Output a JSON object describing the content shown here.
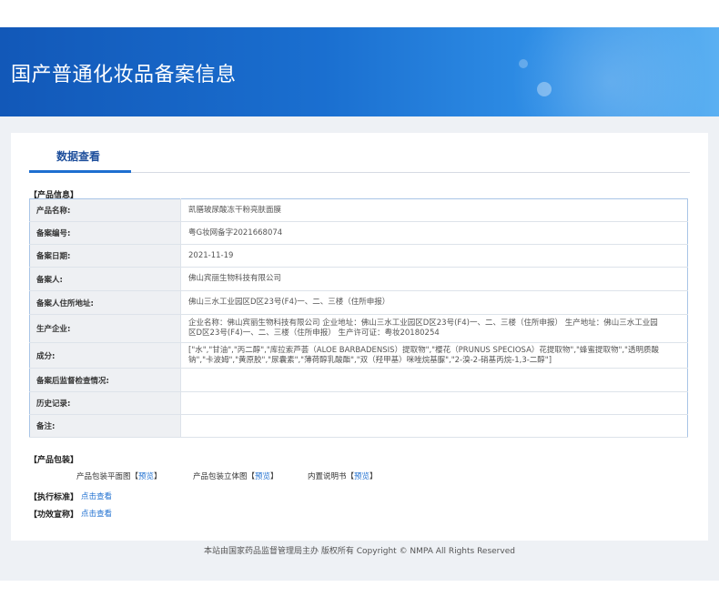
{
  "header": {
    "title": "国产普通化妆品备案信息"
  },
  "tab": {
    "label": "数据查看"
  },
  "product_info": {
    "section_label": "【产品信息】",
    "rows": [
      {
        "label": "产品名称:",
        "value": "凯膳玻尿酸冻干粉亮肤面膜"
      },
      {
        "label": "备案编号:",
        "value": "粤G妆网备字2021668074"
      },
      {
        "label": "备案日期:",
        "value": "2021-11-19"
      },
      {
        "label": "备案人:",
        "value": "佛山宾丽生物科技有限公司"
      },
      {
        "label": "备案人住所地址:",
        "value": "佛山三水工业园区D区23号(F4)一、二、三楼（住所申报）"
      },
      {
        "label": "生产企业:",
        "value": "企业名称：佛山宾丽生物科技有限公司 企业地址：佛山三水工业园区D区23号(F4)一、二、三楼（住所申报） 生产地址：佛山三水工业园区D区23号(F4)一、二、三楼（住所申报） 生产许可证：粤妆20180254"
      },
      {
        "label": "成分:",
        "value": "[\"水\",\"甘油\",\"丙二醇\",\"库拉索芦荟（ALOE BARBADENSIS）提取物\",\"樱花（PRUNUS SPECIOSA）花提取物\",\"蜂蜜提取物\",\"透明质酸钠\",\"卡波姆\",\"黄原胶\",\"尿囊素\",\"薄荷醇乳酸酯\",\"双（羟甲基）咪唑烷基脲\",\"2-溴-2-硝基丙烷-1,3-二醇\"]"
      },
      {
        "label": "备案后监督检查情况:",
        "value": ""
      },
      {
        "label": "历史记录:",
        "value": ""
      },
      {
        "label": "备注:",
        "value": ""
      }
    ]
  },
  "packaging": {
    "section_label": "【产品包装】",
    "items": [
      {
        "label": "产品包装平面图",
        "link": "预览"
      },
      {
        "label": "产品包装立体图",
        "link": "预览"
      },
      {
        "label": "内置说明书",
        "link": "预览"
      }
    ]
  },
  "standard": {
    "label": "【执行标准】",
    "link": "点击查看"
  },
  "efficacy": {
    "label": "【功效宣称】",
    "link": "点击查看"
  },
  "footer": {
    "text": "本站由国家药品监督管理局主办 版权所有 Copyright © NMPA All Rights Reserved"
  },
  "colors": {
    "banner": "#1a6fd0",
    "link": "#1e6fd0",
    "tab_accent": "#1e6fd0"
  }
}
